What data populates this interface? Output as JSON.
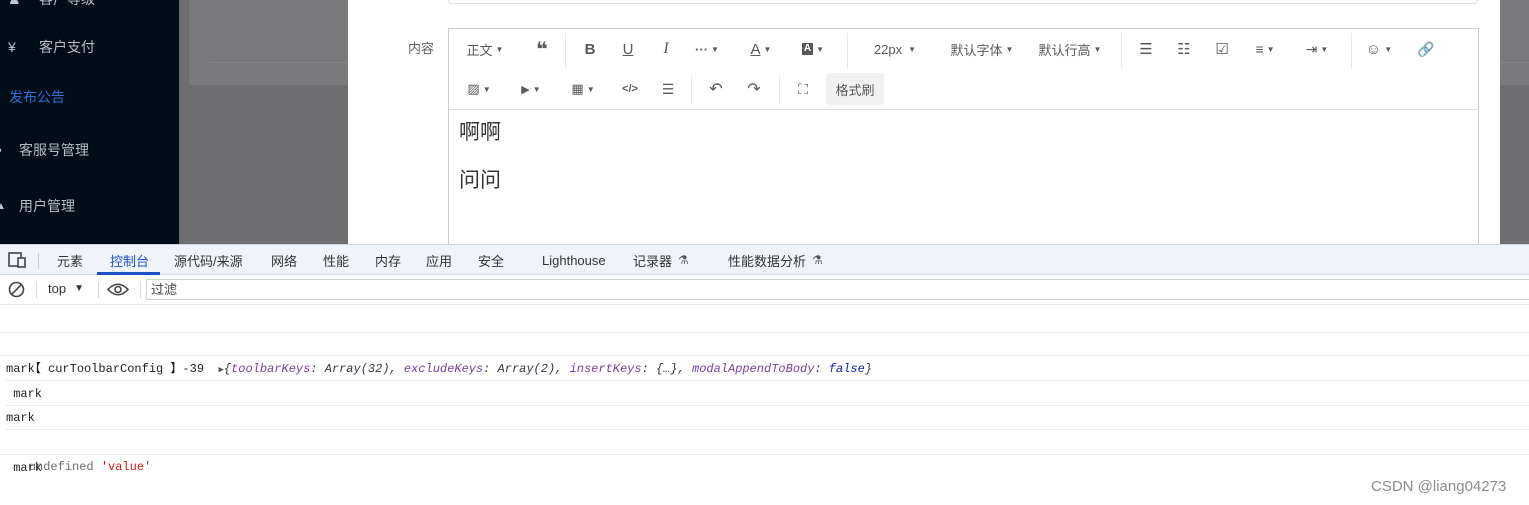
{
  "sidebar": {
    "items": [
      {
        "label": "客户等级",
        "icon": "user-level-icon"
      },
      {
        "label": "客户支付",
        "icon": "yen-icon",
        "icon_glyph": "¥"
      },
      {
        "label": "发布公告",
        "icon": "",
        "active": true
      },
      {
        "label": "客服号管理",
        "icon": "support-icon"
      },
      {
        "label": "用户管理",
        "icon": "user-icon"
      }
    ],
    "colors": {
      "bg": "#010d17",
      "active": "#2d6fd6"
    }
  },
  "modal": {
    "content_label": "内容",
    "toolbar": {
      "heading": "正文",
      "font_size": "22px",
      "font_family": "默认字体",
      "line_height": "默认行高",
      "format_painter": "格式刷"
    },
    "editor_paragraphs": [
      "啊啊",
      "问问"
    ]
  },
  "devtools": {
    "tabs": [
      "元素",
      "控制台",
      "源代码/来源",
      "网络",
      "性能",
      "内存",
      "应用",
      "安全",
      "Lighthouse",
      "记录器",
      "性能数据分析"
    ],
    "active_tab": "控制台",
    "context": "top",
    "filter_placeholder": "过滤",
    "logs": {
      "l1_prefix": "【 curToolbarConfig 】-39",
      "l1_obj_open": "{",
      "l1_k1": "toolbarKeys",
      "l1_v1": "Array(32)",
      "l1_k2": "excludeKeys",
      "l1_v2": "Array(2)",
      "l1_k3": "insertKeys",
      "l1_v3": "{…}",
      "l1_k4": "modalAppendToBody",
      "l1_v4": "false",
      "l1_obj_close": "}",
      "l2": "mark",
      "l3": " mark",
      "l4": "mark",
      "l5_undef": "undefined",
      "l5_str": "'value'",
      "l6": " mark"
    },
    "colors": {
      "accent": "#1a53c5",
      "tabs_bg": "#f0f3f9"
    }
  },
  "watermark": "CSDN @liang04273"
}
